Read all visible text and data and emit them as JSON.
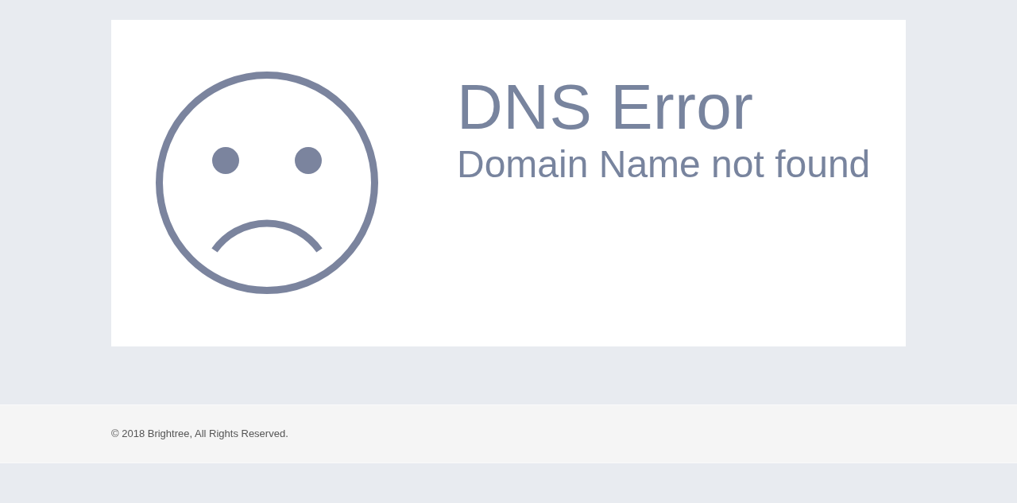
{
  "error_card": {
    "title": "DNS Error",
    "subtitle": "Domain Name not found"
  },
  "footer": {
    "copyright": "© 2018 Brightree, All Rights Reserved."
  }
}
